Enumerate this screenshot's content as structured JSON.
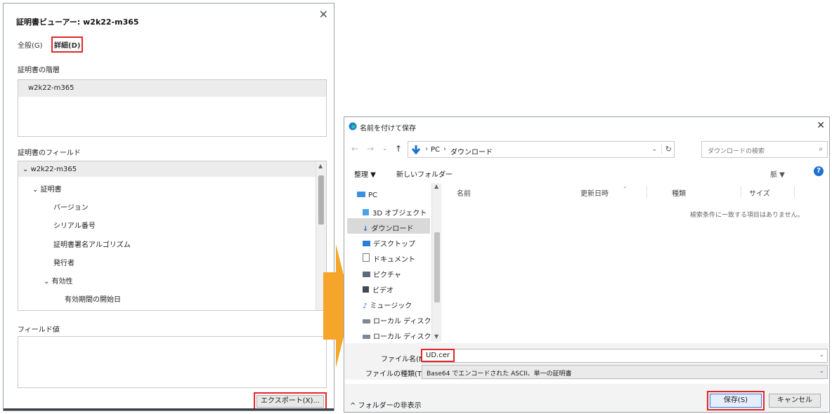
{
  "cert_viewer": {
    "title": "証明書ビューアー: w2k22-m365",
    "tab_general": "全般(G)",
    "tab_details": "詳細(D)",
    "hierarchy_title": "証明書の階層",
    "hierarchy_item": "w2k22-m365",
    "fields_title": "証明書のフィールド",
    "fields": [
      "w2k22-m365",
      "証明書",
      "バージョン",
      "シリアル番号",
      "証明書署名アルゴリズム",
      "発行者",
      "有効性",
      "有効期間の開始日"
    ],
    "value_title": "フィールド値",
    "export_button": "エクスポート(X)..."
  },
  "save_dialog": {
    "title": "名前を付けて保存",
    "path": [
      "PC",
      "ダウンロード"
    ],
    "search_placeholder": "ダウンロードの検索",
    "organize": "整理 ▼",
    "new_folder": "新しいフォルダー",
    "view_label": "脈 ▼",
    "nav_items": [
      {
        "icon": "pc-icon",
        "label": "PC"
      },
      {
        "icon": "3d-objects-icon",
        "label": "3D オブジェクト"
      },
      {
        "icon": "download-icon",
        "label": "ダウンロード"
      },
      {
        "icon": "desktop-icon",
        "label": "デスクトップ"
      },
      {
        "icon": "document-icon",
        "label": "ドキュメント"
      },
      {
        "icon": "pictures-icon",
        "label": "ピクチャ"
      },
      {
        "icon": "video-icon",
        "label": "ビデオ"
      },
      {
        "icon": "music-icon",
        "label": "ミュージック"
      },
      {
        "icon": "local-disk-icon",
        "label": "ローカル ディスク (C"
      },
      {
        "icon": "local-disk-icon",
        "label": "ローカル ディスク (C"
      }
    ],
    "columns": [
      "名前",
      "更新日時",
      "種類",
      "サイズ"
    ],
    "empty_message": "検索条件に一致する項目はありません。",
    "filename_label": "ファイル名(N):",
    "filename_value": "UD.cer",
    "filetype_label": "ファイルの種類(T):",
    "filetype_value": "Base64 でエンコードされた ASCII、単一の証明書",
    "hide_folders": "フォルダーの非表示",
    "save_button": "保存(S)",
    "cancel_button": "キャンセル"
  },
  "colors": {
    "highlight_red": "#e0262b",
    "arrow_orange": "#f5a52a"
  }
}
